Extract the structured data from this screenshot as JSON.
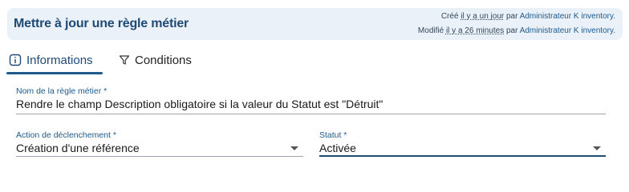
{
  "header": {
    "title": "Mettre à jour une règle métier",
    "created": {
      "prefix": "Créé",
      "when": "il y a un jour",
      "by_label": "par",
      "user": "Administrateur K inventory."
    },
    "modified": {
      "prefix": "Modifié",
      "when": "il y a 26 minutes",
      "by_label": "par",
      "user": "Administrateur K inventory."
    }
  },
  "tabs": [
    {
      "label": "Informations",
      "icon": "info-icon",
      "active": true
    },
    {
      "label": "Conditions",
      "icon": "filter-icon",
      "active": false
    }
  ],
  "form": {
    "rule_name": {
      "label": "Nom de la règle métier *",
      "value": "Rendre le champ Description obligatoire si la valeur du Statut est \"Détruit\""
    },
    "trigger_action": {
      "label": "Action de déclenchement *",
      "value": "Création d'une référence"
    },
    "status": {
      "label": "Statut *",
      "value": "Activée"
    }
  },
  "colors": {
    "accent": "#1e5a8c",
    "header_bg": "#eaf1f8",
    "title": "#1e4a73"
  }
}
